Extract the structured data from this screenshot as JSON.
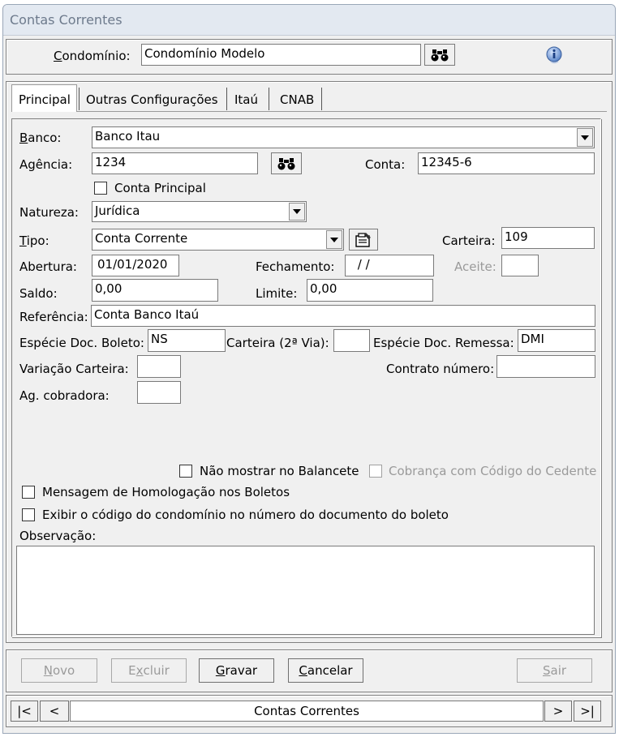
{
  "window": {
    "title": "Contas Correntes"
  },
  "header": {
    "condominio_label": "Condomínio:",
    "condominio_value": "Condomínio Modelo"
  },
  "tabs": [
    "Principal",
    "Outras Configurações",
    "Itaú",
    "CNAB"
  ],
  "form": {
    "banco_label": "Banco:",
    "banco_value": "Banco Itau",
    "agencia_label": "Agência:",
    "agencia_value": "1234",
    "conta_label": "Conta:",
    "conta_value": "12345-6",
    "conta_principal_label": "Conta Principal",
    "natureza_label": "Natureza:",
    "natureza_value": "Jurídica",
    "tipo_label": "Tipo:",
    "tipo_value": "Conta Corrente",
    "carteira_label": "Carteira:",
    "carteira_value": "109",
    "abertura_label": "Abertura:",
    "abertura_value": "01/01/2020",
    "fechamento_label": "Fechamento:",
    "fechamento_value": " / /",
    "aceite_label": "Aceite:",
    "aceite_value": "",
    "saldo_label": "Saldo:",
    "saldo_value": "0,00",
    "limite_label": "Limite:",
    "limite_value": "0,00",
    "referencia_label": "Referência:",
    "referencia_value": "Conta Banco Itaú",
    "especie_boleto_label": "Espécie Doc. Boleto:",
    "especie_boleto_value": "NS",
    "carteira2_label": "Carteira (2ª Via):",
    "carteira2_value": "",
    "especie_remessa_label": "Espécie Doc. Remessa:",
    "especie_remessa_value": "DMI",
    "variacao_label": "Variação Carteira:",
    "variacao_value": "",
    "contrato_label": "Contrato número:",
    "contrato_value": "",
    "ag_cobradora_label": "Ag. cobradora:",
    "ag_cobradora_value": "",
    "nao_mostrar_label": "Não mostrar no Balancete",
    "cobranca_label": "Cobrança com Código do Cedente",
    "mensagem_label": "Mensagem de Homologação nos Boletos",
    "exibir_label": "Exibir o código do condomínio no número do documento do boleto",
    "observacao_label": "Observação:",
    "observacao_value": ""
  },
  "buttons": {
    "novo": "Novo",
    "excluir": "Excluir",
    "gravar": "Gravar",
    "cancelar": "Cancelar",
    "sair": "Sair"
  },
  "nav": {
    "first": "|<",
    "prev": "<",
    "label": "Contas Correntes",
    "next": ">",
    "last": ">|"
  }
}
